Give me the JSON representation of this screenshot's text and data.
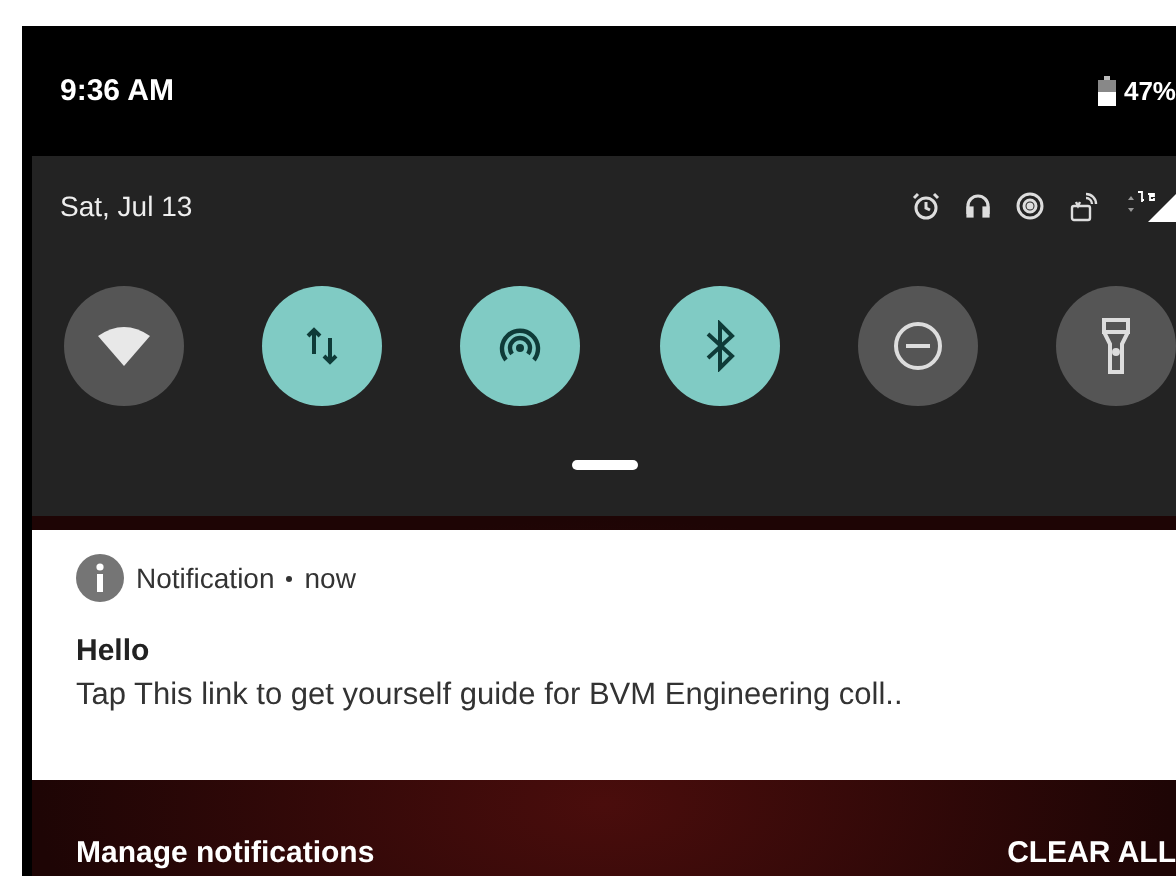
{
  "status_bar": {
    "time": "9:36 AM",
    "battery": "47%"
  },
  "quick_settings": {
    "date": "Sat, Jul 13",
    "tiles": [
      {
        "kind": "wifi",
        "on": false
      },
      {
        "kind": "data",
        "on": true
      },
      {
        "kind": "hotspot",
        "on": true
      },
      {
        "kind": "bluetooth",
        "on": true
      },
      {
        "kind": "dnd",
        "on": false
      },
      {
        "kind": "flashlight",
        "on": false
      }
    ]
  },
  "notification": {
    "app": "Notification",
    "time": "now",
    "title": "Hello",
    "text": "Tap This link to get yourself guide for BVM Engineering coll.."
  },
  "footer": {
    "manage": "Manage notifications",
    "clear": "CLEAR ALL"
  }
}
